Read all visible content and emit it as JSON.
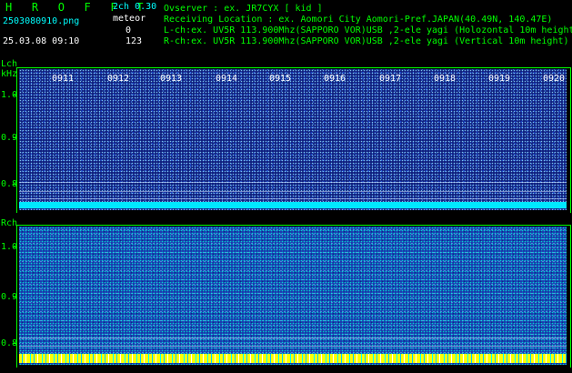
{
  "header": {
    "app_title": "H R O F F T",
    "mode": "2ch 0.30",
    "filename": "2503080910.png",
    "meteor_label": "meteor",
    "meteor_count_l": "0",
    "datetime": "25.03.08 09:10",
    "meteor_count_r": "123",
    "observer": "Ovserver          : ex. JR7CYX [ kid ]",
    "location": "Receiving Location : ex. Aomori City Aomori-Pref.JAPAN(40.49N, 140.47E)",
    "lch_desc": "L-ch:ex. UV5R 113.900Mhz(SAPPORO VOR)USB ,2-ele yagi (Holozontal 10m height",
    "rch_desc": "R-ch:ex. UV5R 113.900Mhz(SAPPORO VOR)USB ,2-ele yagi (Vertical 10m height)"
  },
  "lch": {
    "label": "Lch",
    "unit": "kHz",
    "yticks": [
      "1.0",
      "0.9",
      "0.8"
    ],
    "times": [
      "0911",
      "0912",
      "0913",
      "0914",
      "0915",
      "0916",
      "0917",
      "0918",
      "0919",
      "0920"
    ]
  },
  "rch": {
    "label": "Rch",
    "yticks": [
      "1.0",
      "0.9",
      "0.8"
    ]
  },
  "colors": {
    "text_green": "#00ff00",
    "text_cyan": "#00ffff",
    "lch_bg": "#102080",
    "rch_bg": "#1a3ab0",
    "band_cyan": "#00e8ff",
    "band_yellow": "#ffff00"
  }
}
